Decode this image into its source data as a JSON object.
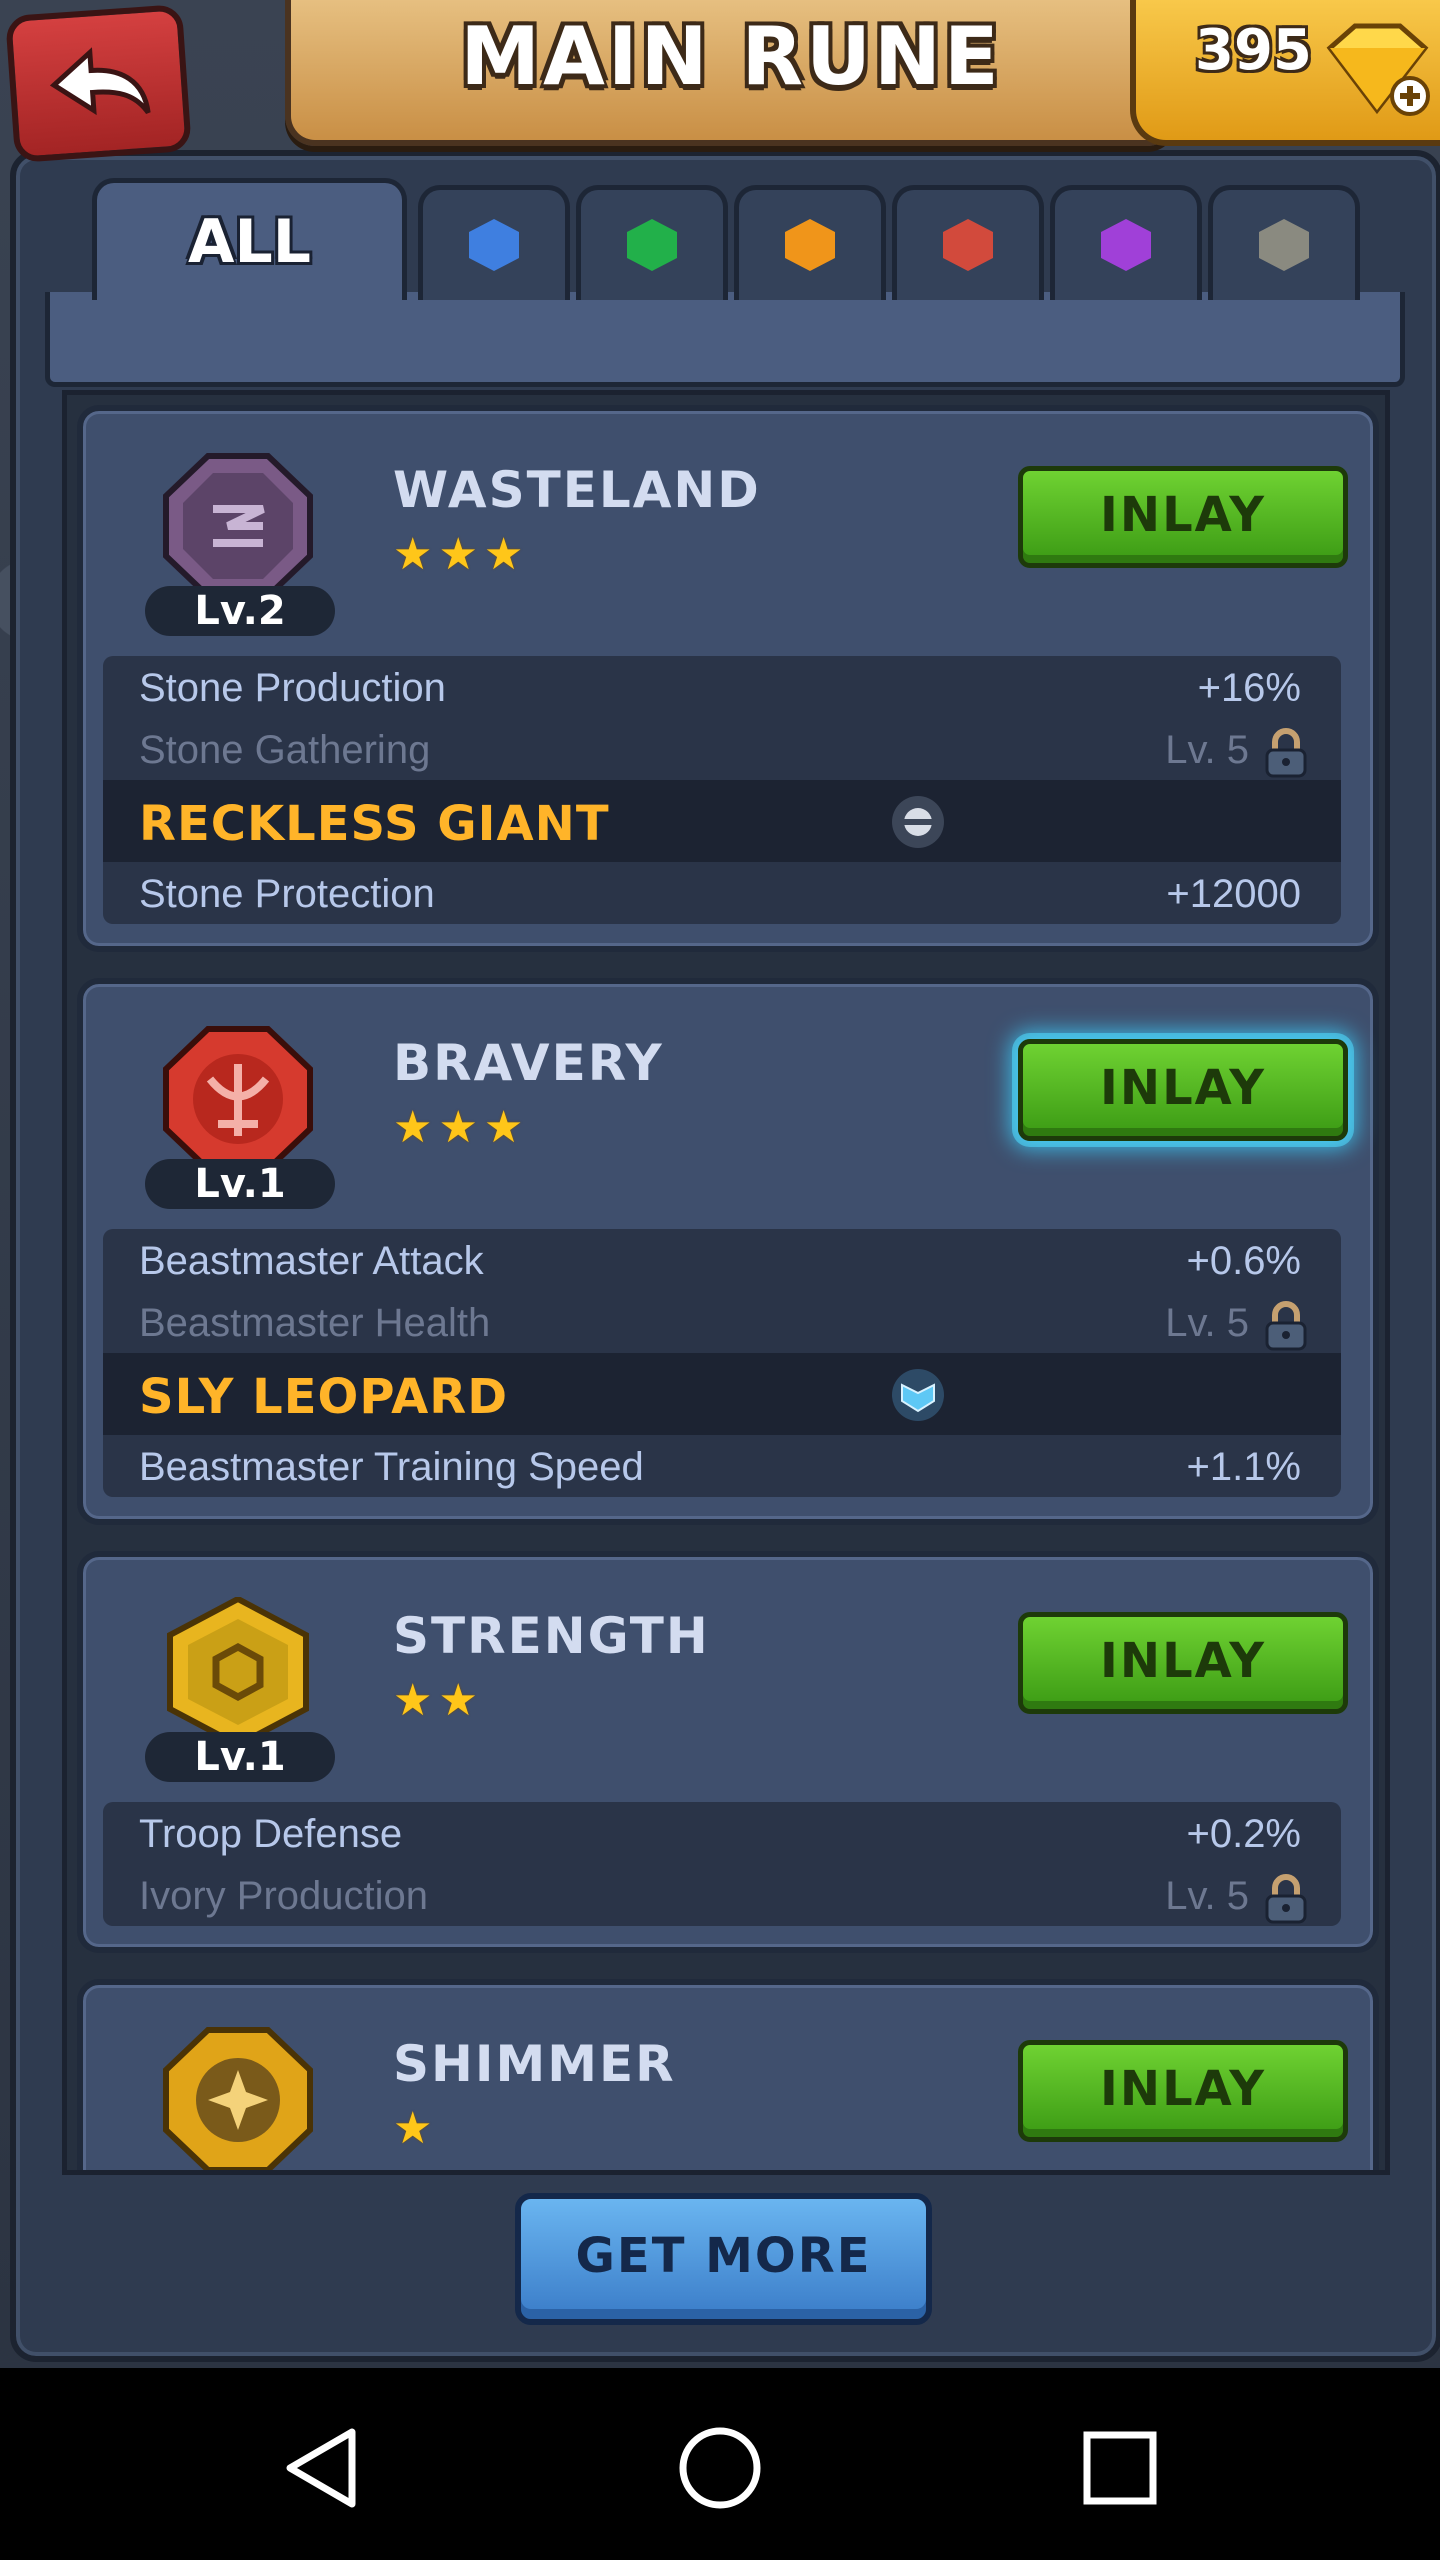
{
  "header": {
    "title": "MAIN RUNE",
    "gems": "395"
  },
  "tabs": [
    {
      "label": "ALL",
      "active": true
    },
    {
      "color": "#3f7fe0",
      "icon": "blue-rune-icon"
    },
    {
      "color": "#22b04a",
      "icon": "green-rune-icon"
    },
    {
      "color": "#f0951a",
      "icon": "orange-rune-icon"
    },
    {
      "color": "#d24a3c",
      "icon": "red-rune-icon"
    },
    {
      "color": "#a040d8",
      "icon": "purple-rune-icon"
    },
    {
      "color": "#8a8a80",
      "icon": "gray-rune-icon"
    }
  ],
  "runes": [
    {
      "name": "WASTELAND",
      "stars": "★★★",
      "level": "Lv.2",
      "button": "INLAY",
      "badge_color": "#7a5a86",
      "icon": "wasteland-rune-icon",
      "stats": [
        {
          "label": "Stone Production",
          "value": "+16%",
          "locked": false
        },
        {
          "label": "Stone Gathering",
          "value": "Lv. 5",
          "locked": true
        }
      ],
      "set_name": "RECKLESS GIANT",
      "extra": {
        "label": "Stone Protection",
        "value": "+12000"
      }
    },
    {
      "name": "BRAVERY",
      "stars": "★★★",
      "level": "Lv.1",
      "button": "INLAY",
      "badge_color": "#d63a2e",
      "icon": "bravery-rune-icon",
      "stats": [
        {
          "label": "Beastmaster Attack",
          "value": "+0.6%",
          "locked": false
        },
        {
          "label": "Beastmaster Health",
          "value": "Lv. 5",
          "locked": true
        }
      ],
      "set_name": "SLY LEOPARD",
      "extra": {
        "label": "Beastmaster Training Speed",
        "value": "+1.1%"
      }
    },
    {
      "name": "STRENGTH",
      "stars": "★★",
      "level": "Lv.1",
      "button": "INLAY",
      "badge_color": "#e8b51f",
      "icon": "strength-rune-icon",
      "stats": [
        {
          "label": "Troop Defense",
          "value": "+0.2%",
          "locked": false
        },
        {
          "label": "Ivory Production",
          "value": "Lv. 5",
          "locked": true
        }
      ]
    },
    {
      "name": "SHIMMER",
      "stars": "★",
      "button": "INLAY",
      "badge_color": "#e0a418",
      "icon": "shimmer-rune-icon"
    }
  ],
  "footer": {
    "get_more": "GET MORE"
  }
}
